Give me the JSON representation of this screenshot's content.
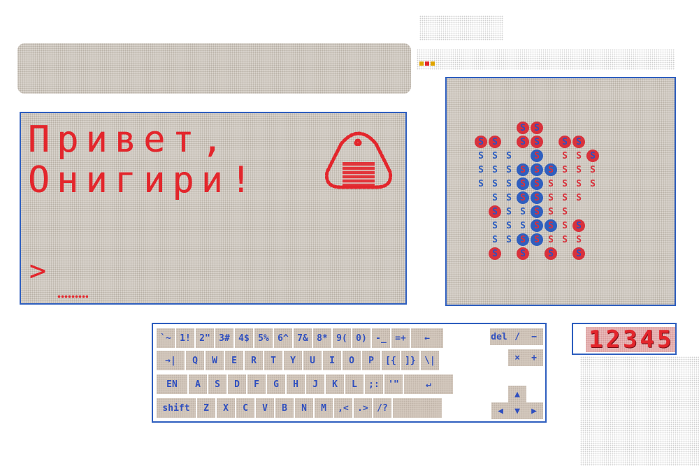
{
  "screen": {
    "greeting_line1": "Привет,",
    "greeting_line2": "Онигири!",
    "prompt": ">",
    "onigiri_icon": "onigiri-icon"
  },
  "sprite": {
    "glyph": "S",
    "rows": [
      [
        0,
        0,
        0,
        1,
        1,
        0,
        0,
        0,
        0
      ],
      [
        1,
        1,
        0,
        1,
        1,
        0,
        1,
        1,
        0
      ],
      [
        3,
        3,
        3,
        0,
        2,
        0,
        4,
        4,
        1
      ],
      [
        3,
        3,
        3,
        2,
        2,
        2,
        4,
        4,
        4
      ],
      [
        3,
        3,
        3,
        2,
        2,
        4,
        4,
        4,
        4
      ],
      [
        0,
        3,
        3,
        2,
        2,
        4,
        4,
        4,
        0
      ],
      [
        0,
        1,
        3,
        3,
        2,
        4,
        4,
        0,
        0
      ],
      [
        0,
        3,
        3,
        3,
        2,
        2,
        4,
        1,
        0
      ],
      [
        0,
        3,
        3,
        2,
        2,
        4,
        4,
        4,
        0
      ],
      [
        0,
        1,
        0,
        1,
        0,
        1,
        0,
        1,
        0
      ]
    ],
    "colors": {
      "red": "#d8323c",
      "blue": "#2f5fbf"
    }
  },
  "keyboard": {
    "row1": [
      "`~",
      "1!",
      "2\"",
      "3#",
      "4$",
      "5%",
      "6^",
      "7&",
      "8*",
      "9(",
      "0)",
      "-_",
      "=+",
      "←"
    ],
    "row2": [
      "→|",
      "Q",
      "W",
      "E",
      "R",
      "T",
      "Y",
      "U",
      "I",
      "O",
      "P",
      "[{",
      "]}",
      "\\|"
    ],
    "row3": [
      "EN",
      "A",
      "S",
      "D",
      "F",
      "G",
      "H",
      "J",
      "K",
      "L",
      ";:",
      "'\"",
      "↵"
    ],
    "row4": [
      "shift",
      "Z",
      "X",
      "C",
      "V",
      "B",
      "N",
      "M",
      ",<",
      ".>",
      "/?",
      ""
    ],
    "edit": {
      "del": "del",
      "slash": "/",
      "minus": "−",
      "times": "×",
      "plus": "+",
      "up": "▲",
      "left": "◀",
      "down": "▼",
      "right": "▶"
    }
  },
  "counter": {
    "value": "12345"
  },
  "colors": {
    "accent_red": "#e3262c",
    "accent_blue": "#2f5fbf",
    "panel": "#d9d3cc"
  }
}
